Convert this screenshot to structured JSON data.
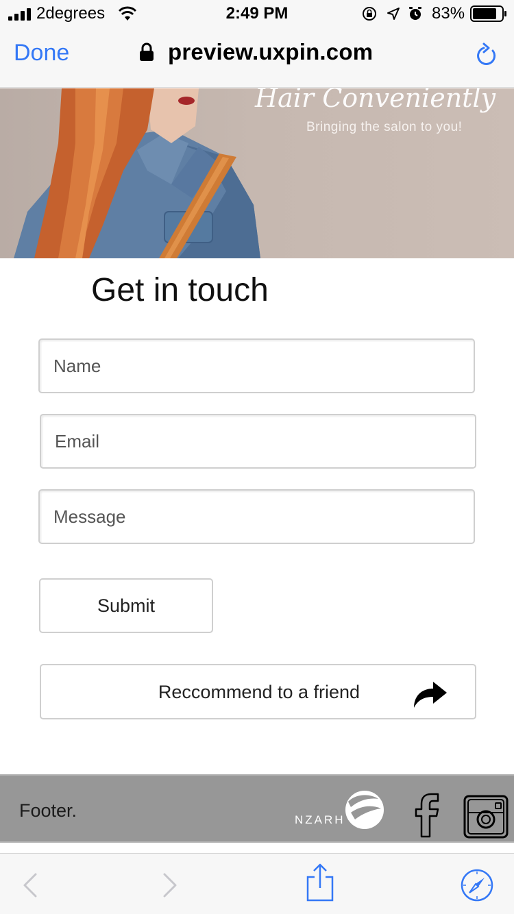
{
  "status_bar": {
    "carrier": "2degrees",
    "time": "2:49 PM",
    "battery_percent": "83%",
    "battery_level": 0.83,
    "icons": [
      "signal-icon",
      "wifi-icon",
      "orientation-lock-icon",
      "location-icon",
      "alarm-icon",
      "battery-icon"
    ]
  },
  "browser": {
    "done_label": "Done",
    "url": "preview.uxpin.com",
    "accent_color": "#3478f6"
  },
  "hero": {
    "tagline": "Hair Conveniently",
    "subtitle": "Bringing the salon to you!"
  },
  "contact": {
    "title": "Get in touch",
    "name_placeholder": "Name",
    "email_placeholder": "Email",
    "message_placeholder": "Message",
    "submit_label": "Submit",
    "recommend_label": "Reccommend to a friend"
  },
  "footer": {
    "text": "Footer.",
    "logo_text": "NZARH",
    "social_icons": [
      "facebook-icon",
      "instagram-icon"
    ],
    "background_color": "#979797"
  },
  "toolbar": {
    "icons": [
      "back-arrow-icon",
      "forward-arrow-icon",
      "share-icon",
      "safari-compass-icon"
    ]
  }
}
